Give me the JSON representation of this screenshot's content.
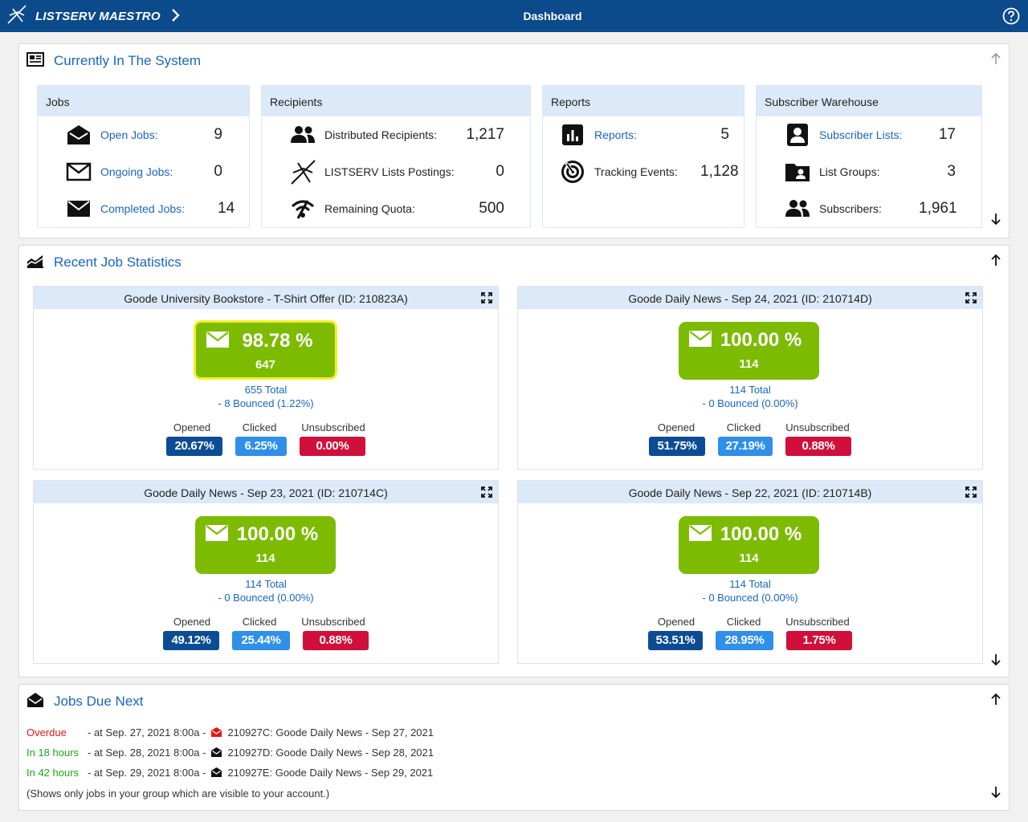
{
  "app": {
    "brand": "LISTSERV MAESTRO",
    "page_title": "Dashboard"
  },
  "system": {
    "title": "Currently In The System",
    "jobs": {
      "header": "Jobs",
      "rows": [
        {
          "label": "Open Jobs:",
          "value": "9"
        },
        {
          "label": "Ongoing Jobs:",
          "value": "0"
        },
        {
          "label": "Completed Jobs:",
          "value": "14"
        }
      ]
    },
    "recipients": {
      "header": "Recipients",
      "rows": [
        {
          "label": "Distributed Recipients:",
          "value": "1,217"
        },
        {
          "label": "LISTSERV Lists Postings:",
          "value": "0"
        },
        {
          "label": "Remaining Quota:",
          "value": "500"
        }
      ]
    },
    "reports": {
      "header": "Reports",
      "rows": [
        {
          "label": "Reports:",
          "value": "5"
        },
        {
          "label": "Tracking Events:",
          "value": "1,128"
        }
      ]
    },
    "warehouse": {
      "header": "Subscriber Warehouse",
      "rows": [
        {
          "label": "Subscriber Lists:",
          "value": "17"
        },
        {
          "label": "List Groups:",
          "value": "3"
        },
        {
          "label": "Subscribers:",
          "value": "1,961"
        }
      ]
    }
  },
  "stats": {
    "title": "Recent Job Statistics",
    "labels": {
      "opened": "Opened",
      "clicked": "Clicked",
      "unsubscribed": "Unsubscribed"
    },
    "cards": [
      {
        "title": "Goode University Bookstore - T-Shirt Offer (ID: 210823A)",
        "pct": "98.78 %",
        "count": "647",
        "total": "655 Total",
        "bounced": "- 8 Bounced (1.22%)",
        "opened": "20.67%",
        "clicked": "6.25%",
        "unsubscribed": "0.00%"
      },
      {
        "title": "Goode Daily News - Sep 24, 2021 (ID: 210714D)",
        "pct": "100.00 %",
        "count": "114",
        "total": "114 Total",
        "bounced": "- 0 Bounced (0.00%)",
        "opened": "51.75%",
        "clicked": "27.19%",
        "unsubscribed": "0.88%"
      },
      {
        "title": "Goode Daily News - Sep 23, 2021 (ID: 210714C)",
        "pct": "100.00 %",
        "count": "114",
        "total": "114 Total",
        "bounced": "- 0 Bounced (0.00%)",
        "opened": "49.12%",
        "clicked": "25.44%",
        "unsubscribed": "0.88%"
      },
      {
        "title": "Goode Daily News - Sep 22, 2021 (ID: 210714B)",
        "pct": "100.00 %",
        "count": "114",
        "total": "114 Total",
        "bounced": "- 0 Bounced (0.00%)",
        "opened": "53.51%",
        "clicked": "28.95%",
        "unsubscribed": "1.75%"
      }
    ]
  },
  "due": {
    "title": "Jobs Due Next",
    "rows": [
      {
        "when": "Overdue",
        "at": "- at Sep. 27, 2021 8:00a -",
        "job": "210927C: Goode Daily News - Sep 27, 2021",
        "status_color": "#e11717"
      },
      {
        "when": "In 18 hours",
        "at": "- at Sep. 28, 2021 8:00a -",
        "job": "210927D: Goode Daily News - Sep 28, 2021",
        "status_color": "#22a31e"
      },
      {
        "when": "In 42 hours",
        "at": "- at Sep. 29, 2021 8:00a -",
        "job": "210927E: Goode Daily News - Sep 29, 2021",
        "status_color": "#22a31e"
      }
    ],
    "note": "(Shows only jobs in your group which are visible to your account.)"
  }
}
